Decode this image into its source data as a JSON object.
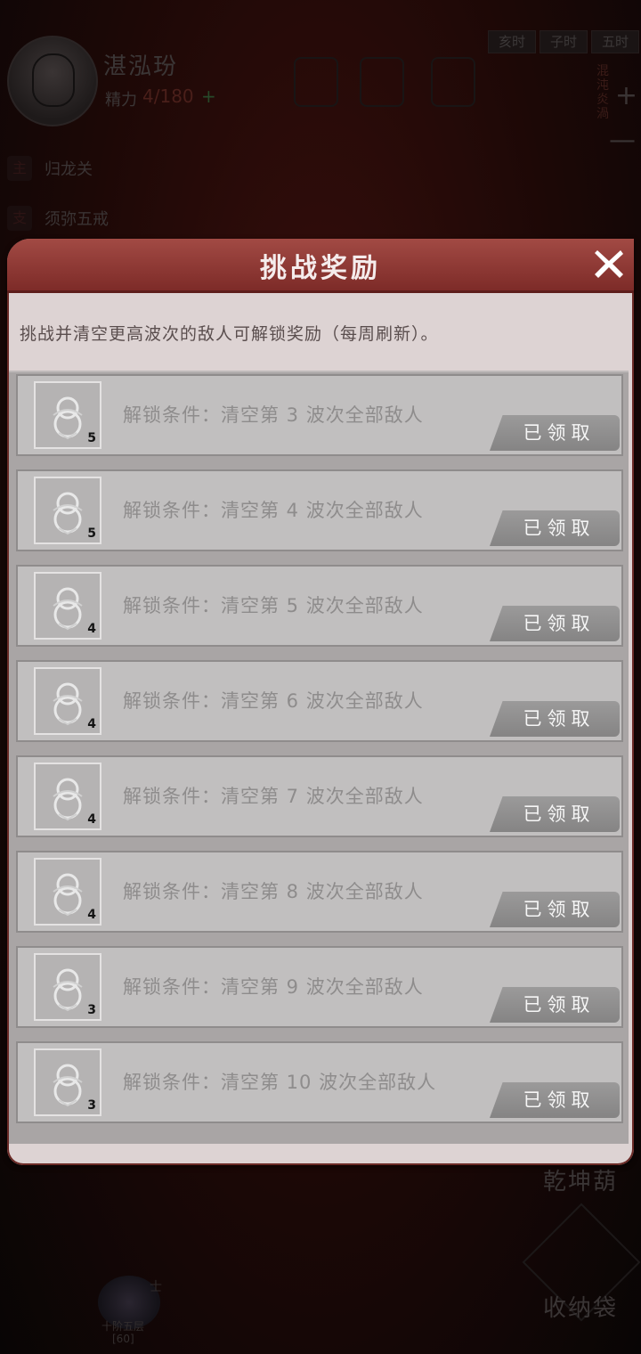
{
  "background": {
    "time_tabs": [
      "亥时",
      "子时",
      "五时"
    ],
    "player": {
      "name": "湛泓玢",
      "energy_label": "精力",
      "energy_value": "4/180",
      "energy_plus": "+"
    },
    "side_vertical_text": "混沌炎渦",
    "quests": [
      {
        "tag": "主",
        "text": "归龙关"
      },
      {
        "tag": "支",
        "text": "须弥五戒"
      }
    ],
    "right_title": "乾坤葫",
    "bag_label": "收纳袋",
    "realm": {
      "badge": "士",
      "label": "十阶五层",
      "stage": "[60]"
    },
    "zoom_plus": "+",
    "zoom_minus": "—"
  },
  "modal": {
    "title": "挑战奖励",
    "close_icon": "close-icon",
    "description": "挑战并清空更高波次的敌人可解锁奖励（每周刷新）。",
    "items": [
      {
        "count": "5",
        "condition": "解锁条件：清空第 3 波次全部敌人",
        "button": "已领取"
      },
      {
        "count": "5",
        "condition": "解锁条件：清空第 4 波次全部敌人",
        "button": "已领取"
      },
      {
        "count": "4",
        "condition": "解锁条件：清空第 5 波次全部敌人",
        "button": "已领取"
      },
      {
        "count": "4",
        "condition": "解锁条件：清空第 6 波次全部敌人",
        "button": "已领取"
      },
      {
        "count": "4",
        "condition": "解锁条件：清空第 7 波次全部敌人",
        "button": "已领取"
      },
      {
        "count": "4",
        "condition": "解锁条件：清空第 8 波次全部敌人",
        "button": "已领取"
      },
      {
        "count": "3",
        "condition": "解锁条件：清空第 9 波次全部敌人",
        "button": "已领取"
      },
      {
        "count": "3",
        "condition": "解锁条件：清空第 10 波次全部敌人",
        "button": "已领取"
      }
    ]
  },
  "colors": {
    "modal_header": "#8a3430",
    "modal_body": "#ddd3d3",
    "item_bg": "#c1bfbf",
    "claimed_button": "#8f8e8e"
  }
}
